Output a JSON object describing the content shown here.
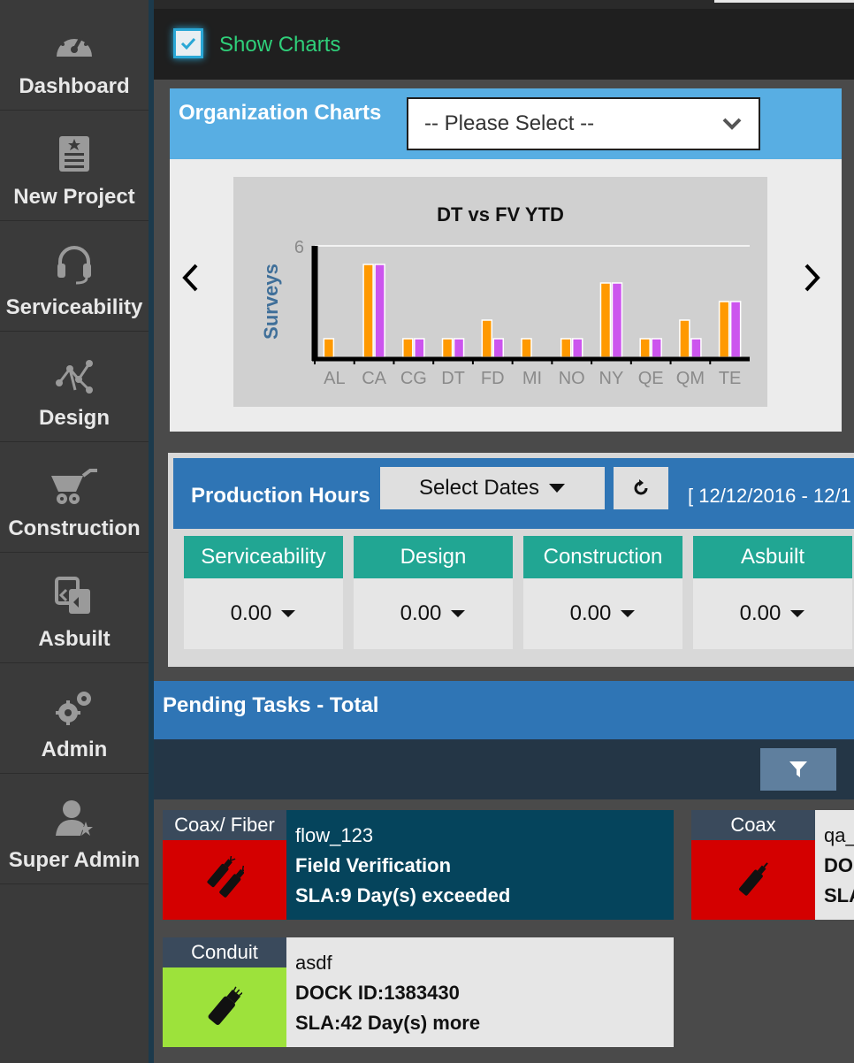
{
  "sidebar": {
    "items": [
      {
        "label": "Dashboard",
        "icon": "speedometer-icon"
      },
      {
        "label": "New Project",
        "icon": "document-star-icon"
      },
      {
        "label": "Serviceability",
        "icon": "headset-icon"
      },
      {
        "label": "Design",
        "icon": "network-nodes-icon"
      },
      {
        "label": "Construction",
        "icon": "wheelbarrow-icon"
      },
      {
        "label": "Asbuilt",
        "icon": "copy-documents-icon"
      },
      {
        "label": "Admin",
        "icon": "gears-icon"
      },
      {
        "label": "Super Admin",
        "icon": "user-star-icon"
      }
    ]
  },
  "topbar": {
    "show_charts_label": "Show Charts",
    "show_charts_checked": true
  },
  "org_charts": {
    "title": "Organization Charts",
    "select_value": "-- Please Select --"
  },
  "chart_data": {
    "type": "bar",
    "title": "DT vs FV YTD",
    "xlabel": "",
    "ylabel": "Surveys",
    "ylim": [
      0,
      6
    ],
    "yticks": [
      "6"
    ],
    "categories": [
      "AL",
      "CA",
      "CG",
      "DT",
      "FD",
      "MI",
      "NO",
      "NY",
      "QE",
      "QM",
      "TE"
    ],
    "series": [
      {
        "color": "#ff9900",
        "values": [
          1,
          5,
          1,
          1,
          2,
          1,
          1,
          4,
          1,
          2,
          3
        ]
      },
      {
        "color": "#cc55ee",
        "values": [
          0,
          5,
          1,
          1,
          1,
          0,
          1,
          4,
          1,
          1,
          3
        ]
      }
    ]
  },
  "production": {
    "title": "Production Hours",
    "select_dates_label": "Select Dates",
    "date_range": "[ 12/12/2016 - 12/1",
    "metrics": [
      {
        "label": "Serviceability",
        "value": "0.00"
      },
      {
        "label": "Design",
        "value": "0.00"
      },
      {
        "label": "Construction",
        "value": "0.00"
      },
      {
        "label": "Asbuilt",
        "value": "0.00"
      }
    ]
  },
  "pending": {
    "title": "Pending Tasks - Total",
    "tasks": [
      {
        "type": "Coax/ Fiber",
        "line1": "flow_123",
        "line2": "Field Verification",
        "line3": "SLA:9 Day(s) exceeded",
        "status_color": "#d40000",
        "icon": "cable-ends-icon"
      },
      {
        "type": "Coax",
        "line1": "qa_",
        "line2": "DO",
        "line3": "SLA",
        "status_color": "#d40000",
        "icon": "cable-end-icon"
      },
      {
        "type": "Conduit",
        "line1": "asdf",
        "line2": "DOCK ID:1383430",
        "line3": "SLA:42 Day(s) more",
        "status_color": "#9de23b",
        "icon": "conduit-icon"
      }
    ]
  },
  "colors": {
    "accent_blue": "#2f75b5",
    "teal": "#21a693",
    "org_header": "#58aee3"
  }
}
